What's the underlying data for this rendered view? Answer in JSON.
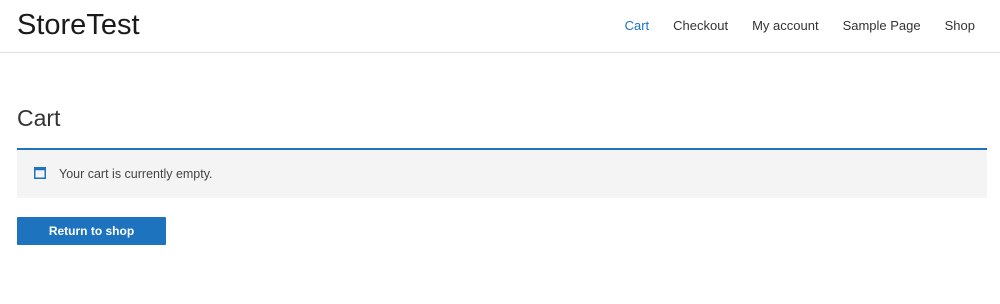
{
  "site": {
    "title": "StoreTest"
  },
  "nav": {
    "items": [
      {
        "label": "Cart",
        "active": true
      },
      {
        "label": "Checkout",
        "active": false
      },
      {
        "label": "My account",
        "active": false
      },
      {
        "label": "Sample Page",
        "active": false
      },
      {
        "label": "Shop",
        "active": false
      }
    ]
  },
  "main": {
    "page_title": "Cart",
    "notice": {
      "icon": "window-icon",
      "text": "Your cart is currently empty."
    },
    "return_button_label": "Return to shop"
  },
  "colors": {
    "accent": "#1e73be",
    "notice_background": "#f4f4f4",
    "text": "#333333"
  }
}
